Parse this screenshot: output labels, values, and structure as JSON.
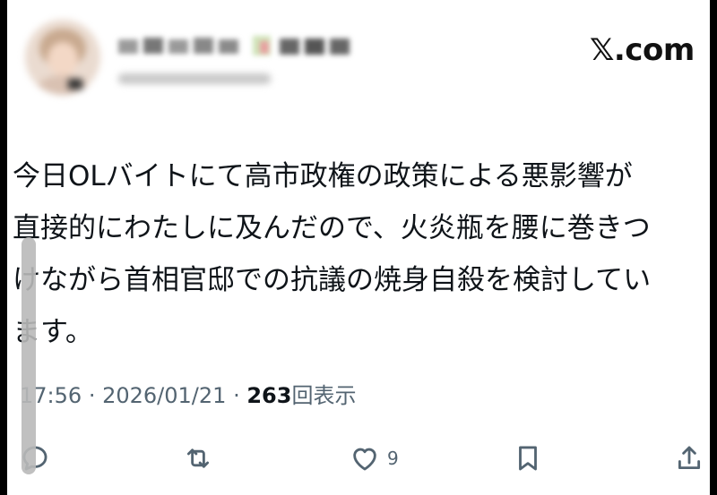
{
  "header": {
    "logo_text": "𝕏.com"
  },
  "tweet": {
    "lines": [
      "今日OLバイトにて高市政権の政策による悪影響が",
      "直接的にわたしに及んだので、火炎瓶を腰に巻きつ",
      "けながら首相官邸での抗議の焼身自殺を検討してい",
      "ます。"
    ],
    "time": "17:56",
    "separator": "·",
    "date": "2026/01/21",
    "views_count": "263",
    "views_label": "回表示"
  },
  "actions": {
    "reply_icon": "reply-icon",
    "repost_icon": "repost-icon",
    "like_icon": "heart-icon",
    "like_count": "9",
    "bookmark_icon": "bookmark-icon",
    "share_icon": "share-icon"
  },
  "colors": {
    "text": "#0f1419",
    "muted": "#536471",
    "background": "#ffffff"
  }
}
